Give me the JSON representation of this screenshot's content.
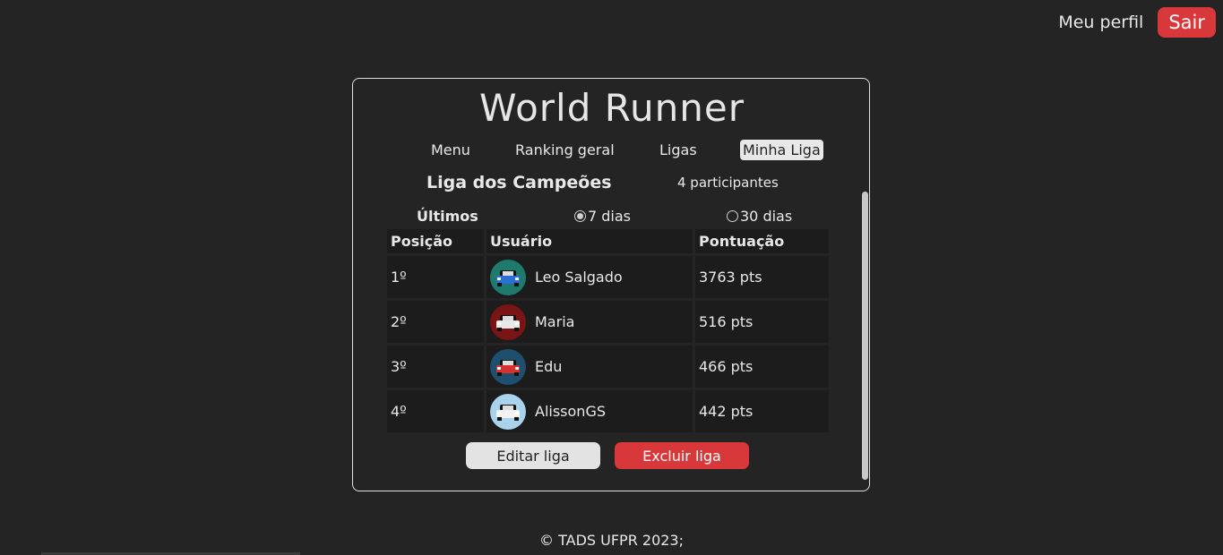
{
  "header": {
    "profile_label": "Meu perfil",
    "exit_label": "Sair"
  },
  "app": {
    "title": "World Runner"
  },
  "nav": {
    "items": [
      {
        "label": "Menu"
      },
      {
        "label": "Ranking geral"
      },
      {
        "label": "Ligas"
      },
      {
        "label": "Minha Liga",
        "active": true
      }
    ]
  },
  "league": {
    "name": "Liga dos Campeões",
    "participants": "4 participantes"
  },
  "period": {
    "label": "Últimos",
    "options": [
      {
        "label": "7 dias",
        "selected": true
      },
      {
        "label": "30 dias",
        "selected": false
      }
    ]
  },
  "table": {
    "headers": [
      "Posição",
      "Usuário",
      "Pontuação"
    ],
    "rows": [
      {
        "position": "1º",
        "user": "Leo Salgado",
        "score": "3763 pts",
        "avatar_bg": "#1f7a6e",
        "car_color": "#2a6fd6"
      },
      {
        "position": "2º",
        "user": "Maria",
        "score": "516 pts",
        "avatar_bg": "#7a1515",
        "car_color": "#e8e8e8"
      },
      {
        "position": "3º",
        "user": "Edu",
        "score": "466 pts",
        "avatar_bg": "#1e4f6e",
        "car_color": "#d63030"
      },
      {
        "position": "4º",
        "user": "AlissonGS",
        "score": "442 pts",
        "avatar_bg": "#a9d2ec",
        "car_color": "#f2f2f2"
      }
    ]
  },
  "actions": {
    "edit_label": "Editar liga",
    "delete_label": "Excluir liga"
  },
  "footer": {
    "text": "© TADS UFPR 2023;"
  },
  "colors": {
    "background": "#242424",
    "danger": "#d9383a",
    "light_button": "#e3e3e3"
  }
}
